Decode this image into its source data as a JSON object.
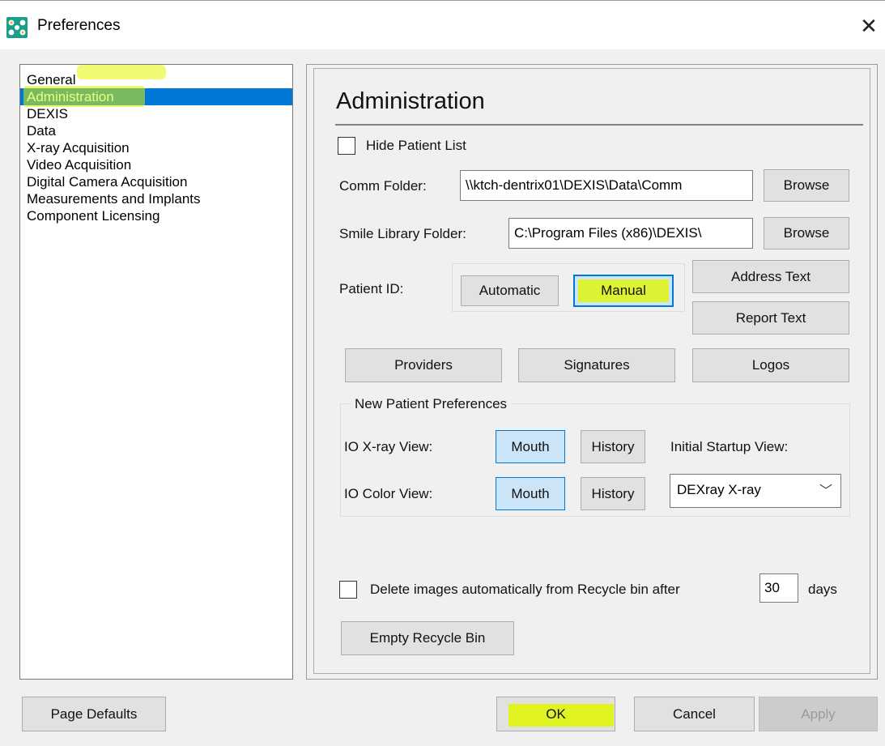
{
  "window": {
    "title": "Preferences",
    "close_glyph": "✕"
  },
  "icons": {
    "app": "dexis-app-icon",
    "close": "close-icon",
    "dropdown": "chevron-down-icon"
  },
  "sidebar": {
    "items": [
      {
        "label": "General"
      },
      {
        "label": "Administration",
        "selected": true
      },
      {
        "label": "DEXIS"
      },
      {
        "label": "Data"
      },
      {
        "label": "X-ray Acquisition"
      },
      {
        "label": "Video Acquisition"
      },
      {
        "label": "Digital Camera Acquisition"
      },
      {
        "label": "Measurements and Implants"
      },
      {
        "label": "Component Licensing"
      }
    ]
  },
  "admin": {
    "heading": "Administration",
    "hide_patient_list": {
      "label": "Hide Patient List",
      "checked": false
    },
    "comm_folder": {
      "label": "Comm Folder:",
      "value": "\\\\ktch-dentrix01\\DEXIS\\Data\\Comm",
      "browse": "Browse"
    },
    "smile_folder": {
      "label": "Smile Library Folder:",
      "value": "C:\\Program Files (x86)\\DEXIS\\",
      "browse": "Browse"
    },
    "patient_id": {
      "label": "Patient ID:",
      "automatic": "Automatic",
      "manual": "Manual",
      "selected": "Manual"
    },
    "address_text": "Address Text",
    "report_text": "Report Text",
    "providers": "Providers",
    "signatures": "Signatures",
    "logos": "Logos",
    "new_patient": {
      "title": "New Patient Preferences",
      "io_xray_label": "IO X-ray View:",
      "io_color_label": "IO Color View:",
      "mouth": "Mouth",
      "history": "History",
      "startup_label": "Initial Startup View:",
      "startup_value": "DEXray X-ray",
      "chevron": "﹀"
    },
    "recycle": {
      "label": "Delete images automatically from Recycle bin after",
      "days_value": "30",
      "days_suffix": "days",
      "checked": false,
      "empty_button": "Empty Recycle Bin"
    }
  },
  "footer": {
    "page_defaults": "Page Defaults",
    "ok": "OK",
    "cancel": "Cancel",
    "apply": "Apply"
  }
}
